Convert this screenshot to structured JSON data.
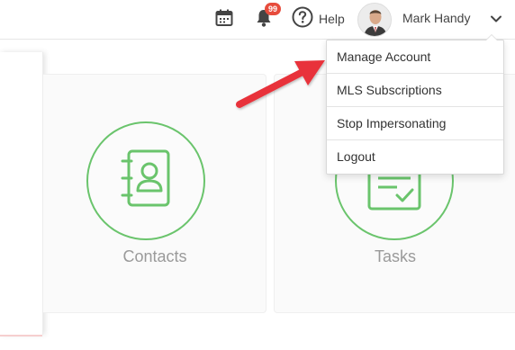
{
  "header": {
    "calendar_icon": "calendar-icon",
    "notifications": {
      "icon": "bell-icon",
      "badge_count": "99",
      "badge_color": "#e74c3c"
    },
    "help": {
      "icon": "question-circle-icon",
      "label": "Help"
    },
    "user": {
      "name": "Mark Handy",
      "chevron_icon": "chevron-down-icon"
    }
  },
  "dropdown": {
    "items": [
      {
        "label": "Manage Account"
      },
      {
        "label": "MLS Subscriptions"
      },
      {
        "label": "Stop Impersonating"
      },
      {
        "label": "Logout"
      }
    ]
  },
  "cards": [
    {
      "label": "Contacts",
      "icon": "address-book-icon"
    },
    {
      "label": "Tasks",
      "icon": "clipboard-check-icon"
    }
  ],
  "colors": {
    "accent_green": "#6ac46c",
    "annotation_red": "#e8333b",
    "text_dark": "#444444",
    "card_label": "#9a9a9a"
  }
}
